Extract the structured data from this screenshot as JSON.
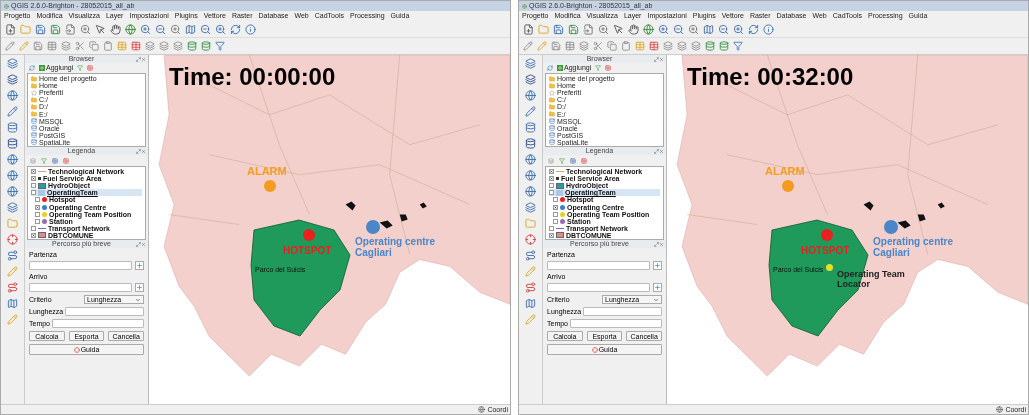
{
  "windows": [
    {
      "title": "QGIS 2.6.0-Brighton - 28052015_all_ab",
      "menu": [
        "Progetto",
        "Modifica",
        "Visualizza",
        "Layer",
        "Impostazioni",
        "Plugins",
        "Vettore",
        "Raster",
        "Database",
        "Web",
        "CadTools",
        "Processing",
        "Guida"
      ],
      "browser": {
        "title": "Browser",
        "add_button": "Aggiungi",
        "items": [
          {
            "label": "Home del progetto",
            "kind": "folder"
          },
          {
            "label": "Home",
            "kind": "folder"
          },
          {
            "label": "Preferiti",
            "kind": "star"
          },
          {
            "label": "C:/",
            "kind": "folder"
          },
          {
            "label": "D:/",
            "kind": "folder"
          },
          {
            "label": "E:/",
            "kind": "folder"
          },
          {
            "label": "MSSQL",
            "kind": "db"
          },
          {
            "label": "Oracle",
            "kind": "db"
          },
          {
            "label": "PostGIS",
            "kind": "db"
          },
          {
            "label": "SpatiaLite",
            "kind": "db"
          }
        ]
      },
      "legend": {
        "title": "Legenda",
        "items": [
          {
            "label": "Technological Network",
            "kind": "line",
            "color": "#d9a07a",
            "checked": true,
            "selected": false
          },
          {
            "label": "Fuel Service Area",
            "kind": "point",
            "color": "#333333",
            "checked": true,
            "selected": false
          },
          {
            "label": "HydroObject",
            "kind": "fill",
            "color": "#2a9aa6",
            "checked": false,
            "selected": false
          },
          {
            "label": "OperatingTeam",
            "kind": "group",
            "color": "#a9c8e8",
            "checked": false,
            "selected": true,
            "children": [
              {
                "label": "Hotspot",
                "kind": "dot",
                "color": "#e8201f",
                "checked": false
              },
              {
                "label": "Operating Centre",
                "kind": "dot",
                "color": "#3b7fc4",
                "checked": true
              },
              {
                "label": "Operating Team Position",
                "kind": "dot",
                "color": "#e6d21f",
                "checked": false
              },
              {
                "label": "Station",
                "kind": "dot",
                "color": "#9b6bb0",
                "checked": false
              }
            ]
          },
          {
            "label": "Transport Network",
            "kind": "line",
            "color": "#6a6ad0",
            "checked": false,
            "selected": false
          },
          {
            "label": "DBTCOMUNE",
            "kind": "fill",
            "color": "#e08a8a",
            "checked": true,
            "selected": false
          }
        ]
      },
      "route": {
        "title": "Percorso più breve",
        "start_label": "Partenza",
        "end_label": "Arrivo",
        "criterion_label": "Criterio",
        "criterion_value": "Lunghezza",
        "length_label": "Lunghezza",
        "time_label": "Tempo",
        "buttons": [
          "Calcola",
          "Esporta",
          "Cancella"
        ],
        "help_button": "Guida"
      },
      "map": {
        "time": "Time: 00:00:00",
        "park_label": "Parco del Sulcis",
        "markers": [
          {
            "kind": "alarm",
            "label": "ALARM",
            "color": "#f39c1f"
          },
          {
            "kind": "hotspot",
            "label": "HOTSPOT",
            "color": "#e8201f"
          },
          {
            "kind": "centre",
            "label": "Operating centre Cagliari",
            "color": "#4a86c8"
          }
        ]
      },
      "status": {
        "coordinate_label": "Coordi"
      }
    },
    {
      "title": "QGIS 2.6.0-Brighton - 28052015_all_ab",
      "menu": [
        "Progetto",
        "Modifica",
        "Visualizza",
        "Layer",
        "Impostazioni",
        "Plugins",
        "Vettore",
        "Raster",
        "Database",
        "Web",
        "CadTools",
        "Processing",
        "Guida"
      ],
      "browser": {
        "title": "Browser",
        "add_button": "Aggiungi",
        "items": [
          {
            "label": "Home del progetto",
            "kind": "folder"
          },
          {
            "label": "Home",
            "kind": "folder"
          },
          {
            "label": "Preferiti",
            "kind": "star"
          },
          {
            "label": "C:/",
            "kind": "folder"
          },
          {
            "label": "D:/",
            "kind": "folder"
          },
          {
            "label": "E:/",
            "kind": "folder"
          },
          {
            "label": "MSSQL",
            "kind": "db"
          },
          {
            "label": "Oracle",
            "kind": "db"
          },
          {
            "label": "PostGIS",
            "kind": "db"
          },
          {
            "label": "SpatiaLite",
            "kind": "db"
          }
        ]
      },
      "legend": {
        "title": "Legenda",
        "items": [
          {
            "label": "Technological Network",
            "kind": "line",
            "color": "#d9a07a",
            "checked": true,
            "selected": false
          },
          {
            "label": "Fuel Service Area",
            "kind": "point",
            "color": "#333333",
            "checked": true,
            "selected": false
          },
          {
            "label": "HydroObject",
            "kind": "fill",
            "color": "#2a9aa6",
            "checked": false,
            "selected": false
          },
          {
            "label": "OperatingTeam",
            "kind": "group",
            "color": "#a9c8e8",
            "checked": false,
            "selected": true,
            "children": [
              {
                "label": "Hotspot",
                "kind": "dot",
                "color": "#e8201f",
                "checked": false
              },
              {
                "label": "Operating Centre",
                "kind": "dot",
                "color": "#3b7fc4",
                "checked": true
              },
              {
                "label": "Operating Team Position",
                "kind": "dot",
                "color": "#e6d21f",
                "checked": false
              },
              {
                "label": "Station",
                "kind": "dot",
                "color": "#9b6bb0",
                "checked": false
              }
            ]
          },
          {
            "label": "Transport Network",
            "kind": "line",
            "color": "#6a6ad0",
            "checked": false,
            "selected": false
          },
          {
            "label": "DBTCOMUNE",
            "kind": "fill",
            "color": "#e08a8a",
            "checked": true,
            "selected": false
          }
        ]
      },
      "route": {
        "title": "Percorso più breve",
        "start_label": "Partenza",
        "end_label": "Arrivo",
        "criterion_label": "Criterio",
        "criterion_value": "Lunghezza",
        "length_label": "Lunghezza",
        "time_label": "Tempo",
        "buttons": [
          "Calcola",
          "Esporta",
          "Cancella"
        ],
        "help_button": "Guida"
      },
      "map": {
        "time": "Time: 00:32:00",
        "park_label": "Parco del Sulcis",
        "markers": [
          {
            "kind": "alarm",
            "label": "ALARM",
            "color": "#f39c1f"
          },
          {
            "kind": "hotspot",
            "label": "HOTSPOT",
            "color": "#e8201f"
          },
          {
            "kind": "centre",
            "label": "Operating centre Cagliari",
            "color": "#4a86c8"
          },
          {
            "kind": "team",
            "label": "Operating Team Locator",
            "color": "#e6e21f"
          }
        ]
      },
      "status": {
        "coordinate_label": "Coordi"
      }
    }
  ]
}
